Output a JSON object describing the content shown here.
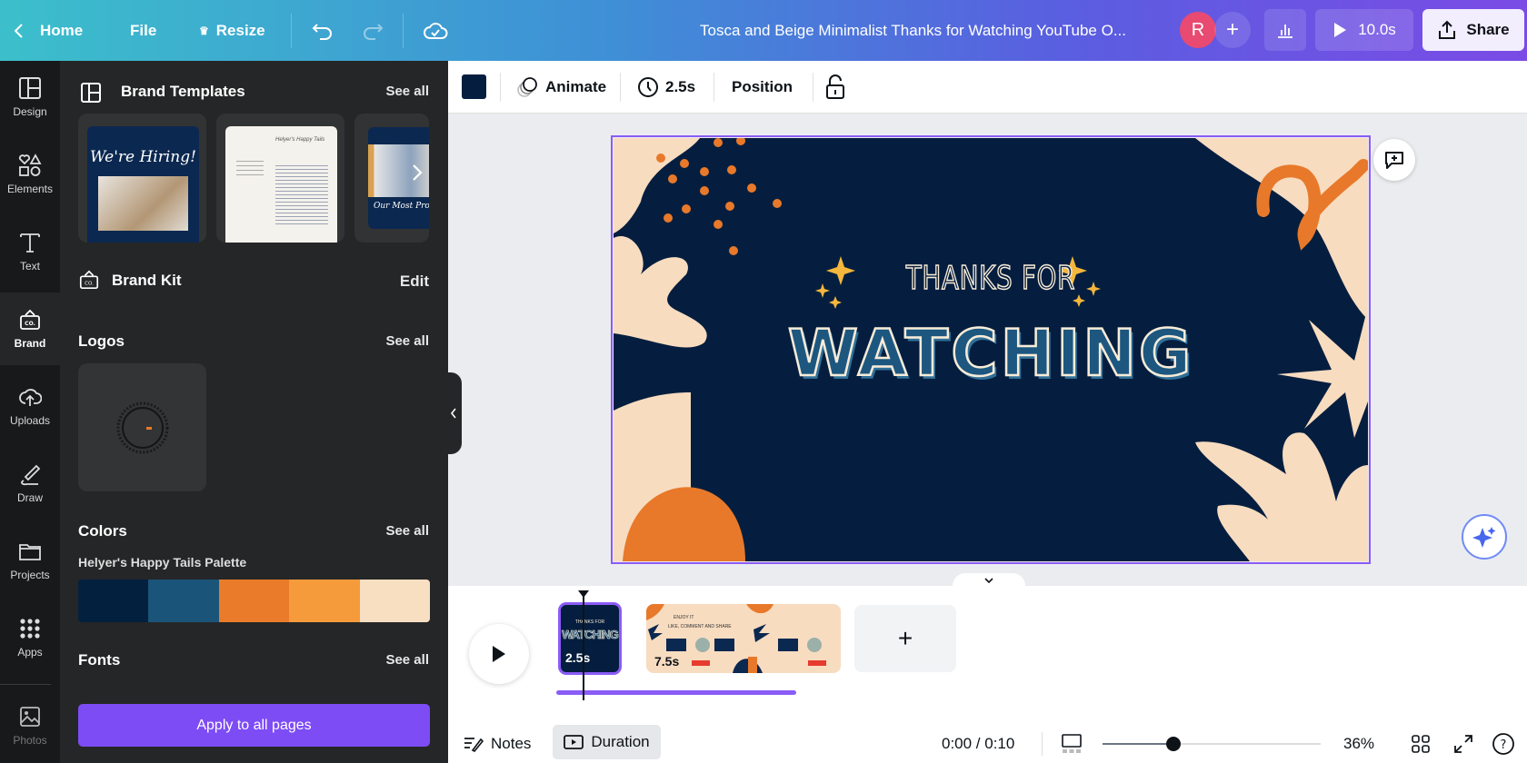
{
  "topbar": {
    "home": "Home",
    "file": "File",
    "resize": "Resize",
    "title": "Tosca and Beige Minimalist Thanks for Watching YouTube O...",
    "avatar_initial": "R",
    "play_duration": "10.0s",
    "share": "Share"
  },
  "rail": [
    {
      "label": "Design",
      "icon": "layout-icon"
    },
    {
      "label": "Elements",
      "icon": "shapes-icon"
    },
    {
      "label": "Text",
      "icon": "text-icon"
    },
    {
      "label": "Brand",
      "icon": "brand-icon",
      "active": true
    },
    {
      "label": "Uploads",
      "icon": "cloud-upload-icon"
    },
    {
      "label": "Draw",
      "icon": "pen-icon"
    },
    {
      "label": "Projects",
      "icon": "folder-icon"
    },
    {
      "label": "Apps",
      "icon": "apps-grid-icon"
    },
    {
      "label": "Photos",
      "icon": "image-icon"
    }
  ],
  "panel": {
    "brand_templates": {
      "title": "Brand Templates",
      "see_all": "See all",
      "thumb1_text": "We're Hiring!",
      "thumb2_text": "Helyer's Happy Tails",
      "thumb3_text": "Our Most Promotion"
    },
    "brand_kit": {
      "title": "Brand Kit",
      "edit": "Edit"
    },
    "logos": {
      "title": "Logos",
      "see_all": "See all"
    },
    "colors": {
      "title": "Colors",
      "see_all": "See all",
      "palette_name": "Helyer's Happy Tails Palette",
      "swatches": [
        "#03203f",
        "#1b5479",
        "#e97b2b",
        "#f59b3b",
        "#f8dfc2"
      ]
    },
    "fonts": {
      "title": "Fonts",
      "see_all": "See all"
    },
    "apply_button": "Apply to all pages"
  },
  "toolbar": {
    "color": "#051e3f",
    "animate": "Animate",
    "duration": "2.5s",
    "position": "Position"
  },
  "design": {
    "line1": "THANKS FOR",
    "line2": "WATCHING",
    "bg": "#051e3f",
    "beige": "#f8dcc0",
    "orange": "#e8792a",
    "text_blue": "#1d5780",
    "sparkle": "#f4b63c"
  },
  "timeline": {
    "clips": [
      {
        "duration": "2.5s",
        "mini_line1": "THANKS FOR",
        "mini_line2": "WATCHING",
        "selected": true
      },
      {
        "duration": "7.5s",
        "mini_line1": "ENJOY IT",
        "mini_line2": "LIKE, COMMENT AND SHARE"
      }
    ]
  },
  "bottombar": {
    "notes": "Notes",
    "duration": "Duration",
    "time": "0:00 / 0:10",
    "zoom": "36%",
    "zoom_level": 36
  },
  "colors": {
    "accent": "#8b5cf6",
    "button": "#7d4cf5"
  }
}
